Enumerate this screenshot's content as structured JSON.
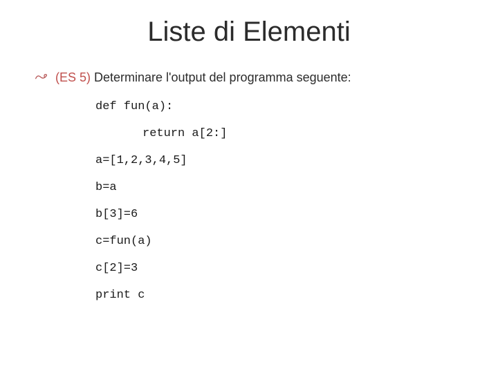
{
  "title": "Liste di Elementi",
  "bullet": {
    "label": "(ES 5)",
    "text": " Determinare l'output del programma seguente:"
  },
  "code": {
    "l1": "def fun(a):",
    "l2": "return a[2:]",
    "l3": "a=[1,2,3,4,5]",
    "l4": "b=a",
    "l5": "b[3]=6",
    "l6": "c=fun(a)",
    "l7": "c[2]=3",
    "l8": "print c"
  }
}
